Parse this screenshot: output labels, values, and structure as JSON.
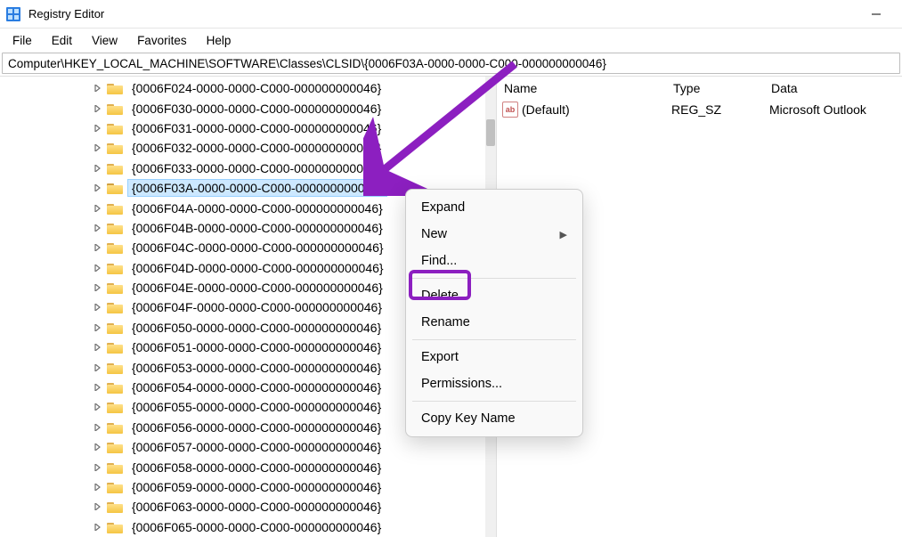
{
  "window": {
    "title": "Registry Editor"
  },
  "menubar": {
    "items": [
      "File",
      "Edit",
      "View",
      "Favorites",
      "Help"
    ]
  },
  "address": "Computer\\HKEY_LOCAL_MACHINE\\SOFTWARE\\Classes\\CLSID\\{0006F03A-0000-0000-C000-000000000046}",
  "tree": {
    "depth": 7,
    "items": [
      {
        "label": "{0006F024-0000-0000-C000-000000000046}",
        "selected": false
      },
      {
        "label": "{0006F030-0000-0000-C000-000000000046}",
        "selected": false
      },
      {
        "label": "{0006F031-0000-0000-C000-000000000046}",
        "selected": false
      },
      {
        "label": "{0006F032-0000-0000-C000-000000000046}",
        "selected": false
      },
      {
        "label": "{0006F033-0000-0000-C000-000000000046}",
        "selected": false
      },
      {
        "label": "{0006F03A-0000-0000-C000-000000000046}",
        "selected": true
      },
      {
        "label": "{0006F04A-0000-0000-C000-000000000046}",
        "selected": false
      },
      {
        "label": "{0006F04B-0000-0000-C000-000000000046}",
        "selected": false
      },
      {
        "label": "{0006F04C-0000-0000-C000-000000000046}",
        "selected": false
      },
      {
        "label": "{0006F04D-0000-0000-C000-000000000046}",
        "selected": false
      },
      {
        "label": "{0006F04E-0000-0000-C000-000000000046}",
        "selected": false
      },
      {
        "label": "{0006F04F-0000-0000-C000-000000000046}",
        "selected": false
      },
      {
        "label": "{0006F050-0000-0000-C000-000000000046}",
        "selected": false
      },
      {
        "label": "{0006F051-0000-0000-C000-000000000046}",
        "selected": false
      },
      {
        "label": "{0006F053-0000-0000-C000-000000000046}",
        "selected": false
      },
      {
        "label": "{0006F054-0000-0000-C000-000000000046}",
        "selected": false
      },
      {
        "label": "{0006F055-0000-0000-C000-000000000046}",
        "selected": false
      },
      {
        "label": "{0006F056-0000-0000-C000-000000000046}",
        "selected": false
      },
      {
        "label": "{0006F057-0000-0000-C000-000000000046}",
        "selected": false
      },
      {
        "label": "{0006F058-0000-0000-C000-000000000046}",
        "selected": false
      },
      {
        "label": "{0006F059-0000-0000-C000-000000000046}",
        "selected": false
      },
      {
        "label": "{0006F063-0000-0000-C000-000000000046}",
        "selected": false
      },
      {
        "label": "{0006F065-0000-0000-C000-000000000046}",
        "selected": false
      }
    ]
  },
  "columns": {
    "name": "Name",
    "type": "Type",
    "data": "Data"
  },
  "values": [
    {
      "icon": "ab",
      "name": "(Default)",
      "type": "REG_SZ",
      "data": "Microsoft Outlook"
    }
  ],
  "context_menu": {
    "groups": [
      [
        {
          "label": "Expand",
          "submenu": false,
          "key": "expand"
        },
        {
          "label": "New",
          "submenu": true,
          "key": "new"
        },
        {
          "label": "Find...",
          "submenu": false,
          "key": "find"
        }
      ],
      [
        {
          "label": "Delete",
          "submenu": false,
          "key": "delete"
        },
        {
          "label": "Rename",
          "submenu": false,
          "key": "rename"
        }
      ],
      [
        {
          "label": "Export",
          "submenu": false,
          "key": "export"
        },
        {
          "label": "Permissions...",
          "submenu": false,
          "key": "permissions"
        }
      ],
      [
        {
          "label": "Copy Key Name",
          "submenu": false,
          "key": "copy-key-name"
        }
      ]
    ]
  }
}
